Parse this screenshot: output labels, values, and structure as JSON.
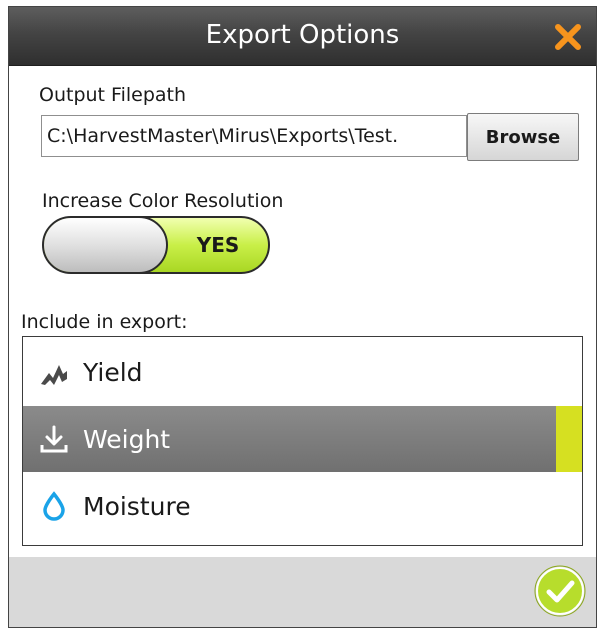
{
  "dialog": {
    "title": "Export Options",
    "close_icon": "close-x-icon"
  },
  "output": {
    "label": "Output Filepath",
    "value": "C:\\HarvestMaster\\Mirus\\Exports\\Test.",
    "browse_label": "Browse"
  },
  "color_resolution": {
    "label": "Increase Color Resolution",
    "state": "YES",
    "on": true
  },
  "include": {
    "label": "Include in export:",
    "items": [
      {
        "label": "Yield",
        "icon": "yield-chart-icon",
        "selected": false
      },
      {
        "label": "Weight",
        "icon": "weight-download-icon",
        "selected": true
      },
      {
        "label": "Moisture",
        "icon": "water-drop-icon",
        "selected": false
      }
    ]
  },
  "footer": {
    "confirm_icon": "checkmark-ok-icon"
  },
  "colors": {
    "accent_orange": "#f7941d",
    "toggle_on_green": "#c9ef48",
    "selected_row": "#7c7c7c",
    "selection_bar": "#d6e021",
    "drop_blue": "#1aa3e8",
    "ok_green": "#b7dd2c"
  }
}
